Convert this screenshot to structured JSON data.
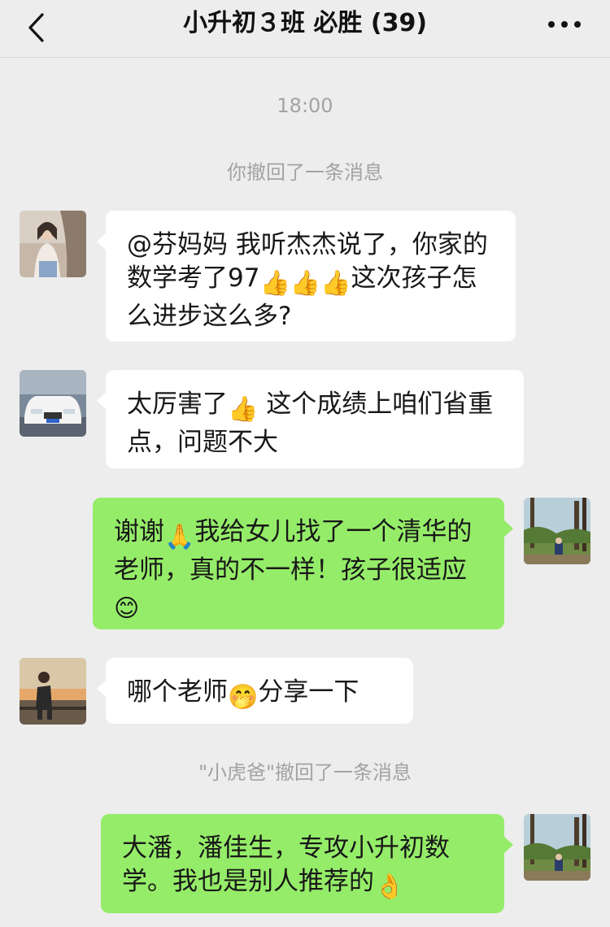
{
  "header": {
    "title": "小升初３班 必胜 (39)",
    "back_icon": "chevron-left-icon",
    "more_icon": "more-dots-icon"
  },
  "chat": {
    "timestamp": "18:00",
    "recall_self": "你撤回了一条消息",
    "recall_other": "\"小虎爸\"撤回了一条消息",
    "messages": [
      {
        "side": "in",
        "segments": [
          "@芬妈妈 我听杰杰说了，你家的数学考了97",
          "👍",
          "👍",
          "👍",
          "这次孩子怎么进步这么多?"
        ]
      },
      {
        "side": "in",
        "segments": [
          "太厉害了",
          "👍",
          " 这个成绩上咱们省重点，问题不大"
        ]
      },
      {
        "side": "out",
        "segments": [
          "谢谢",
          "🙏",
          "我给女儿找了一个清华的老师，真的不一样！孩子很适应",
          "😊"
        ]
      },
      {
        "side": "in",
        "segments": [
          "哪个老师",
          "🤭",
          "分享一下"
        ]
      },
      {
        "side": "out",
        "segments": [
          "大潘，潘佳生，专攻小升初数学。我也是别人推荐的",
          "👌"
        ]
      }
    ]
  },
  "colors": {
    "background": "#ededed",
    "incoming_bubble": "#ffffff",
    "outgoing_bubble": "#95ec69",
    "system_text": "#a3a3a3"
  }
}
